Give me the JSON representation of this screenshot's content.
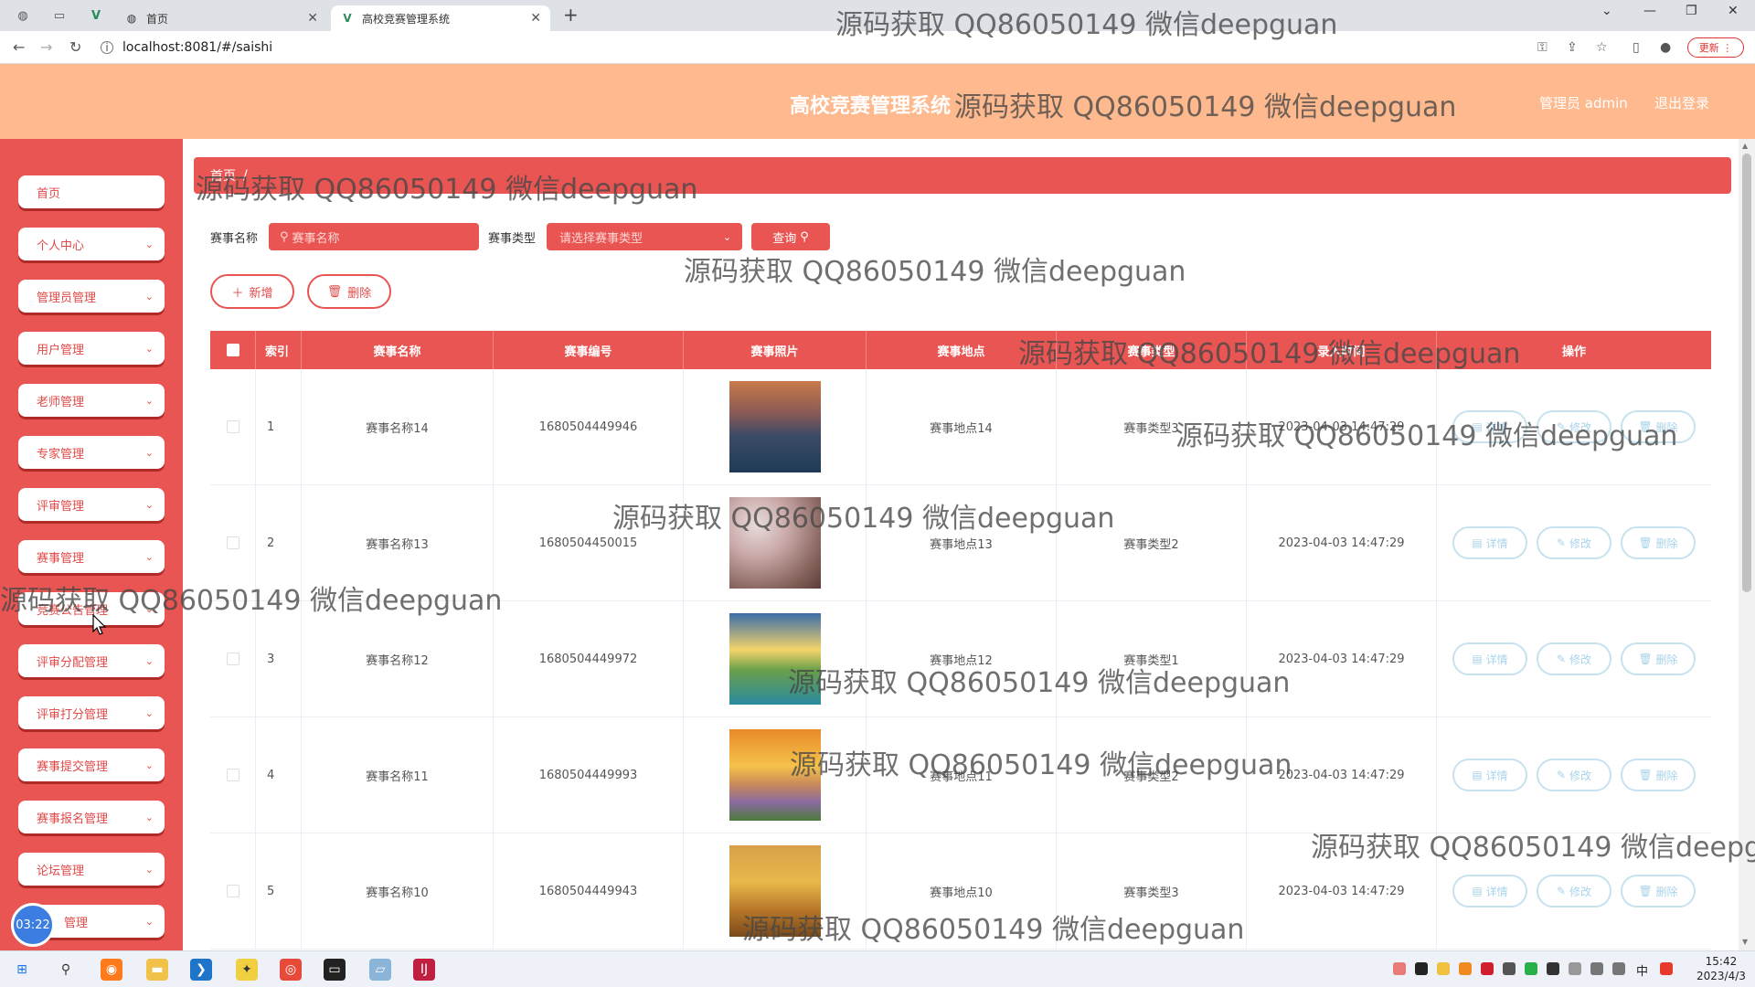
{
  "browser": {
    "tabs": [
      {
        "title": "首页",
        "active": false
      },
      {
        "title": "高校竞赛管理系统",
        "active": true
      }
    ],
    "url": "localhost:8081/#/saishi",
    "update_label": "更新"
  },
  "header": {
    "title": "高校竞赛管理系统",
    "admin_label": "管理员 admin",
    "logout_label": "退出登录"
  },
  "sidebar": {
    "items": [
      {
        "label": "首页",
        "has_chevron": false
      },
      {
        "label": "个人中心",
        "has_chevron": true
      },
      {
        "label": "管理员管理",
        "has_chevron": true
      },
      {
        "label": "用户管理",
        "has_chevron": true
      },
      {
        "label": "老师管理",
        "has_chevron": true
      },
      {
        "label": "专家管理",
        "has_chevron": true
      },
      {
        "label": "评审管理",
        "has_chevron": true
      },
      {
        "label": "赛事管理",
        "has_chevron": true
      },
      {
        "label": "竞赛公告管理",
        "has_chevron": true
      },
      {
        "label": "评审分配管理",
        "has_chevron": true
      },
      {
        "label": "评审打分管理",
        "has_chevron": true
      },
      {
        "label": "赛事提交管理",
        "has_chevron": true
      },
      {
        "label": "赛事报名管理",
        "has_chevron": true
      },
      {
        "label": "论坛管理",
        "has_chevron": true
      },
      {
        "label": "管理",
        "has_chevron": true
      }
    ],
    "timer": "03:22"
  },
  "breadcrumb": {
    "home": "首页",
    "separator": "/"
  },
  "search": {
    "name_label": "赛事名称",
    "name_placeholder": "赛事名称",
    "type_label": "赛事类型",
    "type_placeholder": "请选择赛事类型",
    "query_label": "查询"
  },
  "actions": {
    "add_label": "新增",
    "delete_label": "删除"
  },
  "table": {
    "columns": [
      "索引",
      "赛事名称",
      "赛事编号",
      "赛事照片",
      "赛事地点",
      "赛事类型",
      "录入时间",
      "操作"
    ],
    "rows": [
      {
        "index": "1",
        "name": "赛事名称14",
        "code": "1680504449946",
        "location": "赛事地点14",
        "type": "赛事类型3",
        "time": "2023-04-03 14:47:29"
      },
      {
        "index": "2",
        "name": "赛事名称13",
        "code": "1680504450015",
        "location": "赛事地点13",
        "type": "赛事类型2",
        "time": "2023-04-03 14:47:29"
      },
      {
        "index": "3",
        "name": "赛事名称12",
        "code": "1680504449972",
        "location": "赛事地点12",
        "type": "赛事类型1",
        "time": "2023-04-03 14:47:29"
      },
      {
        "index": "4",
        "name": "赛事名称11",
        "code": "1680504449993",
        "location": "赛事地点11",
        "type": "赛事类型2",
        "time": "2023-04-03 14:47:29"
      },
      {
        "index": "5",
        "name": "赛事名称10",
        "code": "1680504449943",
        "location": "赛事地点10",
        "type": "赛事类型3",
        "time": "2023-04-03 14:47:29"
      }
    ],
    "op_labels": {
      "detail": "详情",
      "edit": "修改",
      "delete": "删除"
    }
  },
  "watermark_text": "源码获取 QQ86050149 微信deepguan",
  "taskbar": {
    "time": "15:42",
    "date": "2023/4/3",
    "ime": "中"
  },
  "colors": {
    "accent": "#e85552",
    "header": "#ffb98e",
    "op_button": "#c6e2f0"
  }
}
